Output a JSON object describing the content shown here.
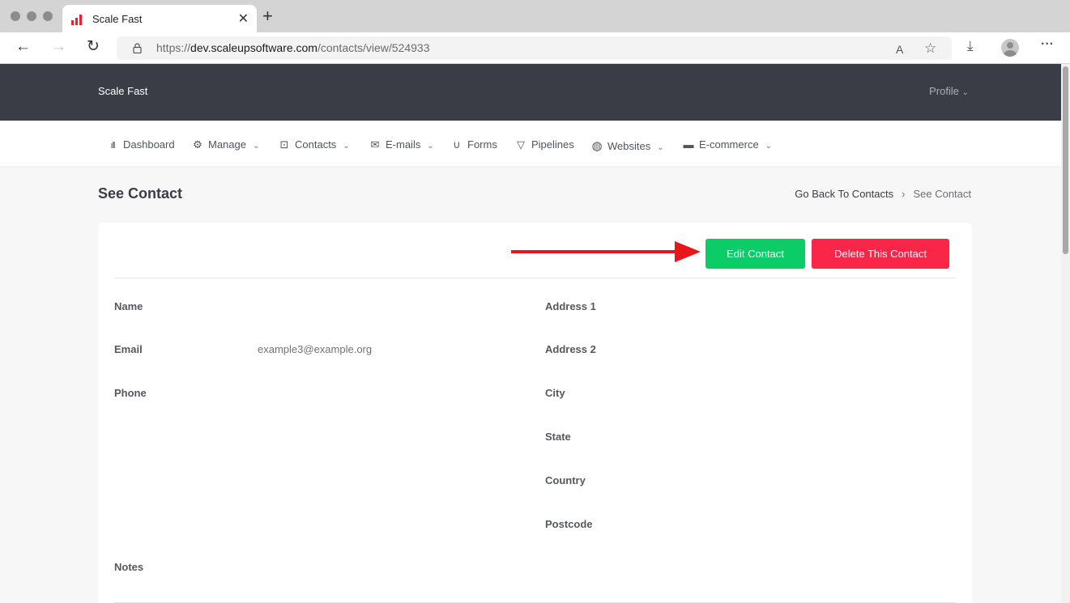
{
  "browser": {
    "tab_title": "Scale Fast",
    "tab_close": "✕",
    "new_tab": "+",
    "url_prefix": "https://",
    "url_host": "dev.scaleupsoftware.com",
    "url_path": "/contacts/view/524933",
    "back": "←",
    "forward": "→",
    "reload": "↻",
    "read_aloud": "A",
    "favorites": "☆",
    "downloads": "⤓",
    "more": "···"
  },
  "header": {
    "brand": "Scale Fast",
    "profile_label": "Profile",
    "profile_chevron": "⌄"
  },
  "menu": {
    "items": [
      {
        "label": "Dashboard",
        "icon": "bar-chart-icon",
        "glyph": "ıll"
      },
      {
        "label": "Manage",
        "icon": "gear-icon",
        "glyph": "⚙",
        "chevron": "⌄"
      },
      {
        "label": "Contacts",
        "icon": "contact-card-icon",
        "glyph": "⊡",
        "chevron": "⌄"
      },
      {
        "label": "E-mails",
        "icon": "envelope-icon",
        "glyph": "✉",
        "chevron": "⌄"
      },
      {
        "label": "Forms",
        "icon": "magnet-icon",
        "glyph": "∪"
      },
      {
        "label": "Pipelines",
        "icon": "filter-icon",
        "glyph": "▽"
      },
      {
        "label": "Websites",
        "icon": "globe-icon",
        "glyph": "◍",
        "chevron": "⌄"
      },
      {
        "label": "E-commerce",
        "icon": "inbox-icon",
        "glyph": "▬",
        "chevron": "⌄"
      }
    ]
  },
  "page": {
    "title": "See Contact",
    "breadcrumb": {
      "back_link": "Go Back To Contacts",
      "separator": "›",
      "current": "See Contact"
    }
  },
  "actions": {
    "edit_label": "Edit Contact",
    "delete_label": "Delete This Contact"
  },
  "contact": {
    "left_fields": [
      {
        "label": "Name",
        "value": ""
      },
      {
        "label": "Email",
        "value": "example3@example.org"
      },
      {
        "label": "Phone",
        "value": ""
      }
    ],
    "right_fields": [
      {
        "label": "Address 1",
        "value": ""
      },
      {
        "label": "Address 2",
        "value": ""
      },
      {
        "label": "City",
        "value": ""
      },
      {
        "label": "State",
        "value": ""
      },
      {
        "label": "Country",
        "value": ""
      },
      {
        "label": "Postcode",
        "value": ""
      }
    ],
    "notes_label": "Notes",
    "notes_value": ""
  },
  "colors": {
    "header_bg": "#3a3d45",
    "edit_button": "#0ccc68",
    "delete_button": "#fa2648",
    "annotation_arrow": "#e8151b"
  }
}
